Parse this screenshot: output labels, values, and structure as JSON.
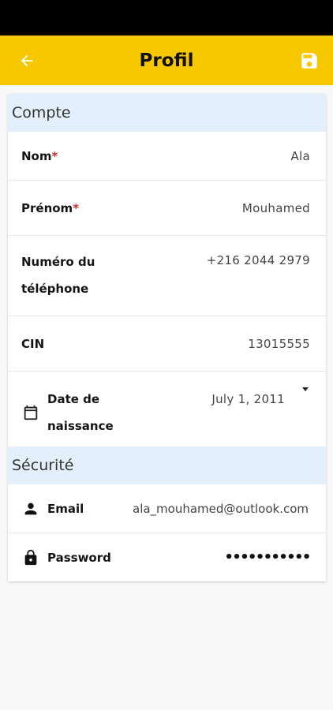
{
  "app_bar": {
    "title": "Profil",
    "back_icon": "arrow-back-icon",
    "save_icon": "save-icon"
  },
  "colors": {
    "app_bar": "#f7c700",
    "section_header": "#e3f0fb",
    "required_mark": "#d32f2f"
  },
  "sections": {
    "compte": {
      "title": "Compte",
      "nom": {
        "label": "Nom",
        "required": "*",
        "value": "Ala"
      },
      "prenom": {
        "label": "Prénom",
        "required": "*",
        "value": "Mouhamed"
      },
      "telephone": {
        "label_line1": "Numéro du",
        "label_line2": "téléphone",
        "value": "+216 2044 2979"
      },
      "cin": {
        "label": "CIN",
        "value": "13015555"
      },
      "date_naissance": {
        "label_line1": "Date de",
        "label_line2": "naissance",
        "value": "July 1, 2011",
        "icon": "calendar-icon"
      }
    },
    "securite": {
      "title": "Sécurité",
      "email": {
        "label": "Email",
        "value": "ala_mouhamed@outlook.com",
        "icon": "person-icon"
      },
      "password": {
        "label": "Password",
        "value": "•••••••••••",
        "icon": "lock-icon"
      }
    }
  }
}
